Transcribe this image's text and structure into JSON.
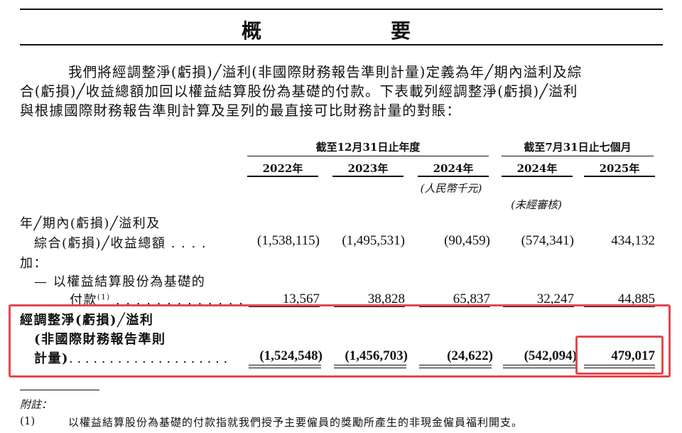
{
  "title": "概　　要",
  "intro": [
    "我們將經調整淨(虧損)╱溢利(非國際財務報告準則計量)定義為年╱期內溢利及綜",
    "合(虧損)╱收益總額加回以權益結算股份為基礎的付款。下表載列經調整淨(虧損)╱溢利",
    "與根據國際財務報告準則計算及呈列的最直接可比財務計量的對賬："
  ],
  "table": {
    "group_headers": [
      "截至12月31日止年度",
      "截至7月31日止七個月"
    ],
    "columns": [
      "2022年",
      "2023年",
      "2024年",
      "2024年",
      "2025年"
    ],
    "unit_label": "(人民幣千元)",
    "unaudited_label": "(未經審核)",
    "rows": [
      {
        "label_lines": [
          "年╱期內(虧損)╱溢利及",
          "綜合(虧損)╱收益總額 . . . ."
        ],
        "values": [
          "(1,538,115)",
          "(1,495,531)",
          "(90,459)",
          "(574,341)",
          "434,132"
        ]
      },
      {
        "label_lines": [
          "加："
        ],
        "values": []
      },
      {
        "label_lines": [
          "— 以權益結算股份為基礎的",
          "付款"
        ],
        "footnote_ref": "(1)",
        "dots": ". . . . . . . . . . . . .",
        "values": [
          "13,567",
          "38,828",
          "65,837",
          "32,247",
          "44,885"
        ]
      },
      {
        "label_lines": [
          "經調整淨(虧損)╱溢利",
          "(非國際財務報告準則",
          "計量)"
        ],
        "dots": ". . . . . . . . . . . . . . . . . . . .",
        "values": [
          "(1,524,548)",
          "(1,456,703)",
          "(24,622)",
          "(542,094)",
          "479,017"
        ]
      }
    ]
  },
  "notes_label": "附註：",
  "notes": [
    {
      "marker": "(1)",
      "text": "以權益結算股份為基礎的付款指就我們授予主要僱員的獎勵所產生的非現金僱員福利開支。"
    }
  ],
  "highlight_color": "#e3484f"
}
